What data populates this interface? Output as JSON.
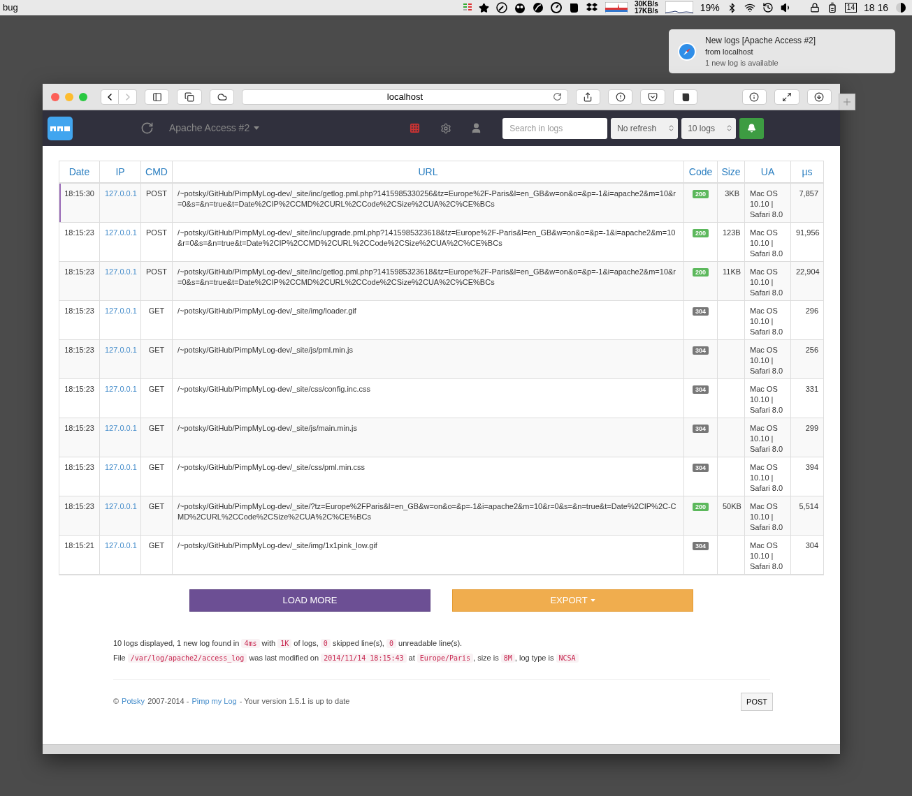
{
  "menubar": {
    "app_name": "bug",
    "net_up": "30KB/s",
    "net_down": "17KB/s",
    "cpu": "19%",
    "calendar_day": "14",
    "clock": "18 16"
  },
  "notification": {
    "title": "New logs [Apache Access #2]",
    "subtitle": "from localhost",
    "body": "1 new log is available"
  },
  "browser": {
    "address": "localhost"
  },
  "navbar": {
    "log_selector": "Apache Access #2",
    "search": {
      "placeholder": "Search in logs"
    },
    "refresh_select": "No refresh",
    "count_select": "10 logs",
    "notifications_on": true
  },
  "table": {
    "columns": [
      "Date",
      "IP",
      "CMD",
      "URL",
      "Code",
      "Size",
      "UA",
      "µs"
    ],
    "rows": [
      {
        "date": "18:15:30",
        "ip": "127.0.0.1",
        "cmd": "POST",
        "url": "/~potsky/GitHub/PimpMyLog-dev/_site/inc/getlog.pml.php?1415985330256&tz=Europe%2F-Paris&l=en_GB&w=on&o=&p=-1&i=apache2&m=10&r=0&s=&n=true&t=Date%2CIP%2CCMD%2CURL%2CCode%2CSize%2CUA%2C%CE%BCs",
        "code": "200",
        "color": "#5cb85c",
        "size": "3KB",
        "ua": "Mac OS 10.10 | Safari 8.0",
        "us": "7,857",
        "new": true
      },
      {
        "date": "18:15:23",
        "ip": "127.0.0.1",
        "cmd": "POST",
        "url": "/~potsky/GitHub/PimpMyLog-dev/_site/inc/upgrade.pml.php?1415985323618&tz=Europe%2F-Paris&l=en_GB&w=on&o=&p=-1&i=apache2&m=10&r=0&s=&n=true&t=Date%2CIP%2CCMD%2CURL%2CCode%2CSize%2CUA%2C%CE%BCs",
        "code": "200",
        "color": "#5cb85c",
        "size": "123B",
        "ua": "Mac OS 10.10 | Safari 8.0",
        "us": "91,956",
        "new": false
      },
      {
        "date": "18:15:23",
        "ip": "127.0.0.1",
        "cmd": "POST",
        "url": "/~potsky/GitHub/PimpMyLog-dev/_site/inc/getlog.pml.php?1415985323618&tz=Europe%2F-Paris&l=en_GB&w=on&o=&p=-1&i=apache2&m=10&r=0&s=&n=true&t=Date%2CIP%2CCMD%2CURL%2CCode%2CSize%2CUA%2C%CE%BCs",
        "code": "200",
        "color": "#5cb85c",
        "size": "11KB",
        "ua": "Mac OS 10.10 | Safari 8.0",
        "us": "22,904",
        "new": false
      },
      {
        "date": "18:15:23",
        "ip": "127.0.0.1",
        "cmd": "GET",
        "url": "/~potsky/GitHub/PimpMyLog-dev/_site/img/loader.gif",
        "code": "304",
        "color": "#777777",
        "ua": "Mac OS 10.10 | Safari 8.0",
        "us": "296",
        "new": false
      },
      {
        "date": "18:15:23",
        "ip": "127.0.0.1",
        "cmd": "GET",
        "url": "/~potsky/GitHub/PimpMyLog-dev/_site/js/pml.min.js",
        "code": "304",
        "color": "#777777",
        "ua": "Mac OS 10.10 | Safari 8.0",
        "us": "256",
        "new": false
      },
      {
        "date": "18:15:23",
        "ip": "127.0.0.1",
        "cmd": "GET",
        "url": "/~potsky/GitHub/PimpMyLog-dev/_site/css/config.inc.css",
        "code": "304",
        "color": "#777777",
        "ua": "Mac OS 10.10 | Safari 8.0",
        "us": "331",
        "new": false
      },
      {
        "date": "18:15:23",
        "ip": "127.0.0.1",
        "cmd": "GET",
        "url": "/~potsky/GitHub/PimpMyLog-dev/_site/js/main.min.js",
        "code": "304",
        "color": "#777777",
        "ua": "Mac OS 10.10 | Safari 8.0",
        "us": "299",
        "new": false
      },
      {
        "date": "18:15:23",
        "ip": "127.0.0.1",
        "cmd": "GET",
        "url": "/~potsky/GitHub/PimpMyLog-dev/_site/css/pml.min.css",
        "code": "304",
        "color": "#777777",
        "ua": "Mac OS 10.10 | Safari 8.0",
        "us": "394",
        "new": false
      },
      {
        "date": "18:15:23",
        "ip": "127.0.0.1",
        "cmd": "GET",
        "url": "/~potsky/GitHub/PimpMyLog-dev/_site/?tz=Europe%2FParis&l=en_GB&w=on&o=&p=-1&i=apache2&m=10&r=0&s=&n=true&t=Date%2CIP%2C-CMD%2CURL%2CCode%2CSize%2CUA%2C%CE%BCs",
        "code": "200",
        "color": "#5cb85c",
        "size": "50KB",
        "ua": "Mac OS 10.10 | Safari 8.0",
        "us": "5,514",
        "new": false
      },
      {
        "date": "18:15:21",
        "ip": "127.0.0.1",
        "cmd": "GET",
        "url": "/~potsky/GitHub/PimpMyLog-dev/_site/img/1x1pink_low.gif",
        "code": "304",
        "color": "#777777",
        "ua": "Mac OS 10.10 | Safari 8.0",
        "us": "304",
        "new": false
      }
    ]
  },
  "buttons": {
    "load_more": "LOAD MORE",
    "export": "EXPORT"
  },
  "summary": [
    [
      {
        "t": "10 logs displayed, 1 new log found in "
      },
      {
        "t": "4ms",
        "code": true
      },
      {
        "t": " with "
      },
      {
        "t": "1K",
        "code": true
      },
      {
        "t": " of logs, "
      },
      {
        "t": "0",
        "code": true
      },
      {
        "t": " skipped line(s), "
      },
      {
        "t": "0",
        "code": true
      },
      {
        "t": " unreadable line(s)."
      }
    ],
    [
      {
        "t": "File "
      },
      {
        "t": "/var/log/apache2/access_log",
        "code": true
      },
      {
        "t": " was last modified on "
      },
      {
        "t": "2014/11/14 18:15:43",
        "code": true
      },
      {
        "t": " at "
      },
      {
        "t": "Europe/Paris",
        "code": true
      },
      {
        "t": ", size is "
      },
      {
        "t": "8M",
        "code": true
      },
      {
        "t": ", log type is "
      },
      {
        "t": "NCSA",
        "code": true
      }
    ]
  ],
  "footer": {
    "copyright": "©",
    "author_link": "Potsky",
    "years": "2007-2014 -",
    "product_link": "Pimp my Log",
    "version_text": "- Your version 1.5.1 is up to date",
    "method_badge": "POST"
  }
}
